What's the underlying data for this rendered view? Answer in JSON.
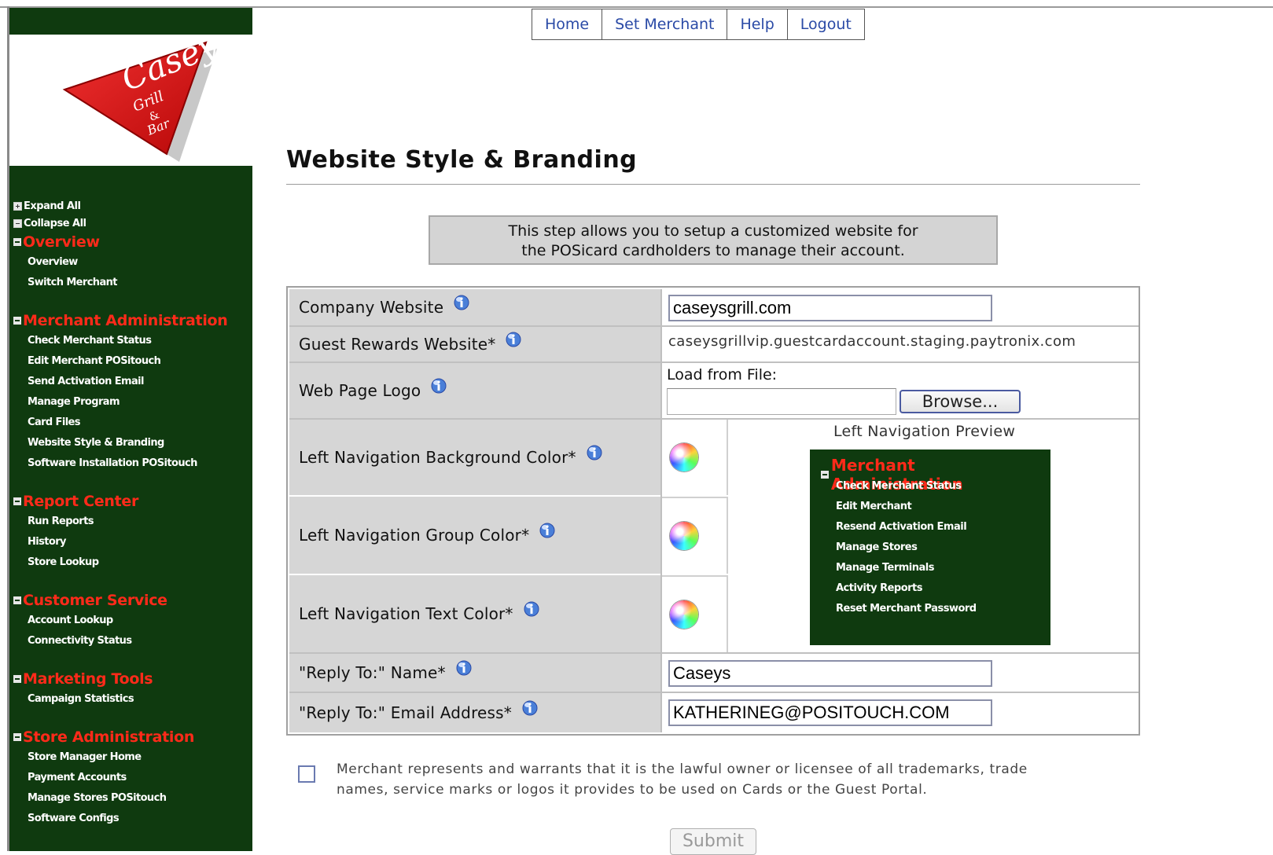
{
  "topnav": [
    "Home",
    "Set Merchant",
    "Help",
    "Logout"
  ],
  "logo": {
    "name": "Caseys",
    "sub1": "Grill",
    "sub2": "&",
    "sub3": "Bar"
  },
  "sidebar": {
    "expand_all": "Expand All",
    "collapse_all": "Collapse All",
    "groups": [
      {
        "title": "Overview",
        "items": [
          "Overview",
          "Switch Merchant"
        ]
      },
      {
        "title": "Merchant Administration",
        "items": [
          "Check Merchant Status",
          "Edit Merchant POSitouch",
          "Send Activation Email",
          "Manage Program",
          "Card Files",
          "Website Style & Branding",
          "Software Installation POSitouch"
        ]
      },
      {
        "title": "Report Center",
        "items": [
          "Run Reports",
          "History",
          "Store Lookup"
        ]
      },
      {
        "title": "Customer Service",
        "items": [
          "Account Lookup",
          "Connectivity Status"
        ]
      },
      {
        "title": "Marketing Tools",
        "items": [
          "Campaign Statistics"
        ]
      },
      {
        "title": "Store Administration",
        "items": [
          "Store Manager Home",
          "Payment Accounts",
          "Manage Stores POSitouch",
          "Software Configs"
        ]
      }
    ]
  },
  "page": {
    "title": "Website Style & Branding",
    "info_line1": "This step allows you to setup a customized website for",
    "info_line2": "the POSicard cardholders to manage their account."
  },
  "form": {
    "company_website_label": "Company Website",
    "company_website_value": "caseysgrill.com",
    "guest_rewards_label": "Guest Rewards Website*",
    "guest_rewards_value": "caseysgrillvip.guestcardaccount.staging.paytronix.com",
    "logo_label": "Web Page Logo",
    "load_from_file": "Load from File:",
    "browse": "Browse...",
    "nav_bg_label": "Left Navigation Background Color*",
    "nav_group_label": "Left Navigation Group Color*",
    "nav_text_label": "Left Navigation Text Color*",
    "reply_name_label": "\"Reply To:\" Name*",
    "reply_name_value": "Caseys",
    "reply_email_label": "\"Reply To:\" Email Address*",
    "reply_email_value": "KATHERINEG@POSITOUCH.COM"
  },
  "preview": {
    "title": "Left Navigation Preview",
    "group": "Merchant Administration",
    "items": [
      "Check Merchant Status",
      "Edit Merchant",
      "Resend Activation Email",
      "Manage Stores",
      "Manage Terminals",
      "Activity Reports",
      "Reset Merchant Password"
    ]
  },
  "agreement": {
    "line1": "Merchant represents and warrants that it is the lawful owner or licensee of all trademarks, trade",
    "line2": "names, service marks or logos it provides to be used on Cards or the Guest Portal."
  },
  "submit": "Submit",
  "colors": {
    "nav_bg": "#0f3a0f",
    "group": "#ff2a1a",
    "text": "#ffffff",
    "link": "#2a4aa6"
  }
}
